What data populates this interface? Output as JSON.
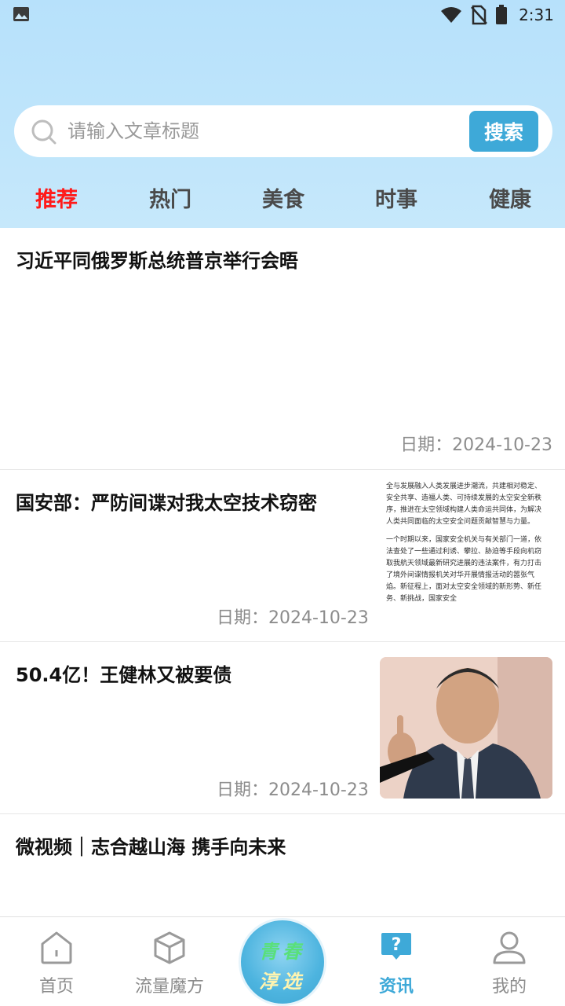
{
  "status_bar": {
    "time": "2:31"
  },
  "search": {
    "placeholder": "请输入文章标题",
    "button_label": "搜索"
  },
  "tabs": [
    {
      "label": "推荐",
      "active": true
    },
    {
      "label": "热门",
      "active": false
    },
    {
      "label": "美食",
      "active": false
    },
    {
      "label": "时事",
      "active": false
    },
    {
      "label": "健康",
      "active": false
    }
  ],
  "articles": [
    {
      "title": "习近平同俄罗斯总统普京举行会晤",
      "date": "日期：2024-10-23"
    },
    {
      "title": "国安部：严防间谍对我太空技术窃密",
      "date": "日期：2024-10-23",
      "thumb_text": [
        "全与发展融入人类发展进步潮流，共建相对稳定、安全共享、造福人类、可持续发展的太空安全新秩序，推进在太空领域构建人类命运共同体，为解决人类共同面临的太空安全问题贡献智慧与力量。",
        "一个时期以来，国家安全机关与有关部门一道，依法查处了一些通过利诱、攀拉、胁迫等手段向机窃取我航天领域最新研究进展的违法案件，有力打击了境外间谍情报机关对华开展情报活动的嚣张气焰。新征程上，面对太空安全领域的新形势、新任务、新挑战，国家安全"
      ]
    },
    {
      "title": "50.4亿！王健林又被要债",
      "date": "日期：2024-10-23"
    },
    {
      "title": "微视频｜志合越山海 携手向未来",
      "date": ""
    }
  ],
  "bottom_nav": {
    "items": [
      {
        "label": "首页",
        "icon": "home-icon",
        "active": false
      },
      {
        "label": "流量魔方",
        "icon": "cube-icon",
        "active": false
      },
      {
        "label": "资讯",
        "icon": "question-bubble-icon",
        "active": true
      },
      {
        "label": "我的",
        "icon": "user-icon",
        "active": false
      }
    ],
    "center_badge": {
      "line1": "青春",
      "line2": "淳选"
    }
  },
  "colors": {
    "accent": "#3ea9d8",
    "active_tab": "#ff1a1a",
    "header": "#bfe5fb"
  }
}
